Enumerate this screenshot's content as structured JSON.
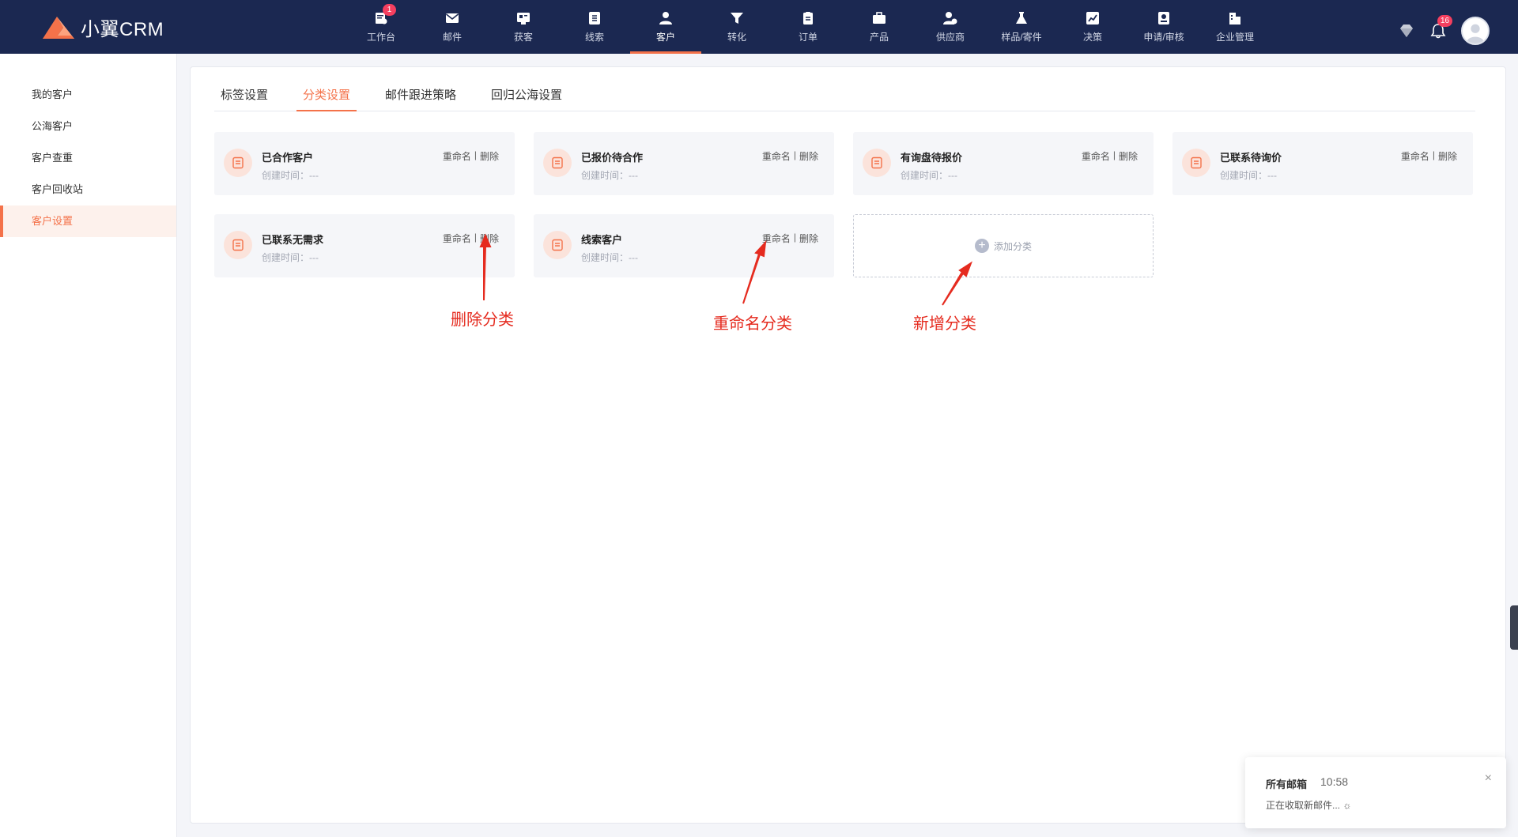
{
  "app": {
    "logo_text": "小翼CRM"
  },
  "nav": {
    "items": [
      {
        "label": "工作台",
        "badge": "1"
      },
      {
        "label": "邮件"
      },
      {
        "label": "获客"
      },
      {
        "label": "线索"
      },
      {
        "label": "客户",
        "active": true
      },
      {
        "label": "转化"
      },
      {
        "label": "订单"
      },
      {
        "label": "产品"
      },
      {
        "label": "供应商"
      },
      {
        "label": "样品/寄件"
      },
      {
        "label": "决策"
      },
      {
        "label": "申请/审核"
      },
      {
        "label": "企业管理"
      }
    ],
    "notification_badge": "16"
  },
  "sidebar": {
    "items": [
      {
        "label": "我的客户"
      },
      {
        "label": "公海客户"
      },
      {
        "label": "客户查重"
      },
      {
        "label": "客户回收站"
      },
      {
        "label": "客户设置",
        "active": true
      }
    ]
  },
  "tabs": [
    {
      "label": "标签设置"
    },
    {
      "label": "分类设置",
      "active": true
    },
    {
      "label": "邮件跟进策略"
    },
    {
      "label": "回归公海设置"
    }
  ],
  "cards": [
    {
      "title": "已合作客户",
      "created": "创建时间：---"
    },
    {
      "title": "已报价待合作",
      "created": "创建时间：---"
    },
    {
      "title": "有询盘待报价",
      "created": "创建时间：---"
    },
    {
      "title": "已联系待询价",
      "created": "创建时间：---"
    },
    {
      "title": "已联系无需求",
      "created": "创建时间：---"
    },
    {
      "title": "线索客户",
      "created": "创建时间：---"
    }
  ],
  "card_actions": {
    "rename": "重命名",
    "separator": "|",
    "delete": "删除"
  },
  "add_card": {
    "label": "添加分类"
  },
  "annotations": {
    "delete": "删除分类",
    "rename": "重命名分类",
    "add": "新增分类"
  },
  "toast": {
    "title": "所有邮箱",
    "time": "10:58",
    "subtitle": "正在收取新邮件... ☼",
    "close": "×"
  },
  "colors": {
    "accent": "#f4724a",
    "nav_bg": "#1b2851",
    "annotation": "#e52b1f",
    "badge": "#f53f5f"
  }
}
